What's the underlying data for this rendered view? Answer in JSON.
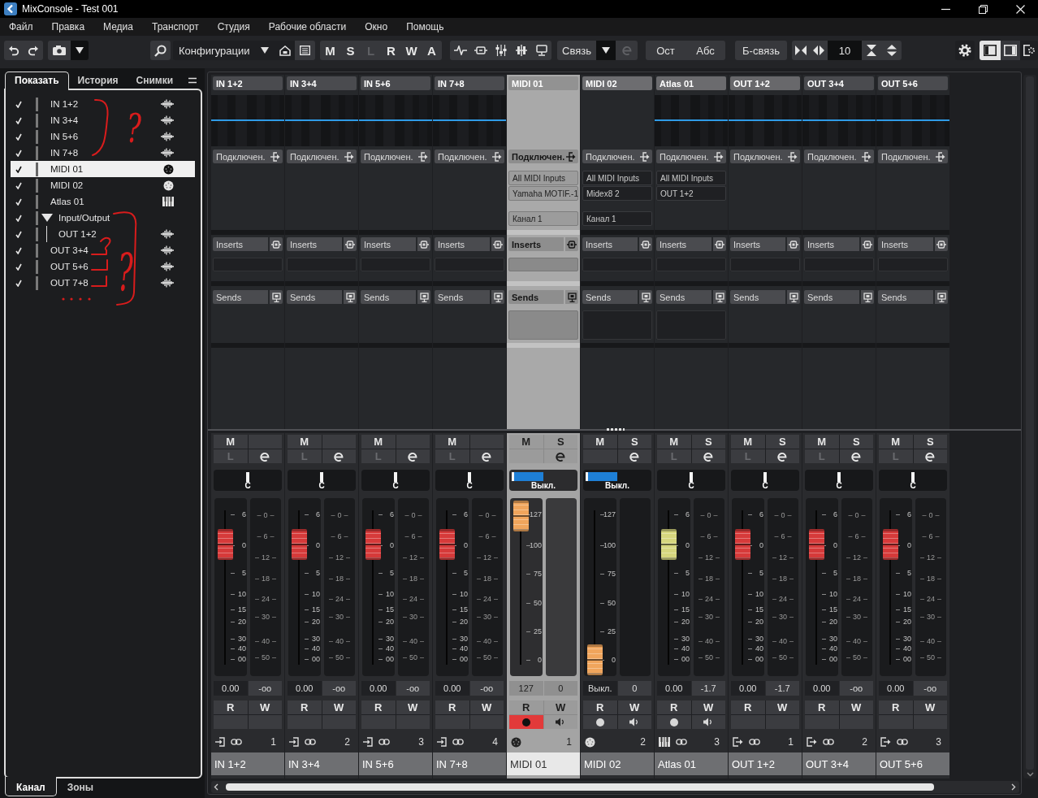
{
  "window": {
    "title": "MixConsole - Test 001"
  },
  "menu": [
    "Файл",
    "Правка",
    "Медиа",
    "Транспорт",
    "Студия",
    "Рабочие области",
    "Окно",
    "Помощь"
  ],
  "toolbar": {
    "configurations": "Конфигурации",
    "channel_buttons": [
      {
        "label": "M",
        "disabled": false
      },
      {
        "label": "S",
        "disabled": false
      },
      {
        "label": "L",
        "disabled": true
      },
      {
        "label": "R",
        "disabled": false
      },
      {
        "label": "W",
        "disabled": false
      },
      {
        "label": "A",
        "disabled": false
      }
    ],
    "link": "Связь",
    "mode_buttons": [
      "Ост",
      "Абс"
    ],
    "q_link": "Б-связь",
    "zoom": "10",
    "panel_toggles": [
      {
        "selected": true
      },
      {
        "selected": false
      }
    ]
  },
  "left_panel": {
    "tabs": [
      {
        "label": "Показать",
        "selected": true
      },
      {
        "label": "История",
        "selected": false
      },
      {
        "label": "Снимки",
        "selected": false
      }
    ],
    "channel_list": [
      {
        "name": "IN 1+2",
        "kind": "audio",
        "checked": true,
        "selected": false
      },
      {
        "name": "IN 3+4",
        "kind": "audio",
        "checked": true,
        "selected": false
      },
      {
        "name": "IN 5+6",
        "kind": "audio",
        "checked": true,
        "selected": false
      },
      {
        "name": "IN 7+8",
        "kind": "audio",
        "checked": true,
        "selected": false
      },
      {
        "name": "MIDI 01",
        "kind": "midi",
        "checked": true,
        "selected": true
      },
      {
        "name": "MIDI 02",
        "kind": "midi",
        "checked": true,
        "selected": false
      },
      {
        "name": "Atlas 01",
        "kind": "instrument",
        "checked": true,
        "selected": false
      },
      {
        "name": "Input/Output",
        "kind": "folder",
        "checked": true,
        "selected": false,
        "expanded": true,
        "children": [
          {
            "name": "OUT 1+2",
            "kind": "audio",
            "checked": true,
            "selected": false
          }
        ]
      },
      {
        "name": "OUT 3+4",
        "kind": "audio",
        "checked": true,
        "selected": false
      },
      {
        "name": "OUT 5+6",
        "kind": "audio",
        "checked": true,
        "selected": false
      },
      {
        "name": "OUT 7+8",
        "kind": "audio",
        "checked": true,
        "selected": false
      }
    ],
    "bottom_tabs": [
      {
        "label": "Канал",
        "selected": true
      },
      {
        "label": "Зоны",
        "selected": false
      }
    ],
    "annotations": [
      "?",
      "?"
    ]
  },
  "channels": [
    {
      "header": "IN 1+2",
      "kind": "input",
      "selected": false,
      "color": "#4a4b4f",
      "routing": "Подключен.",
      "inserts": "Inserts",
      "sends": "Sends",
      "mute": "M",
      "listen": "L",
      "pan": {
        "kind": "balance",
        "label": "C",
        "level": 0.5
      },
      "fader": {
        "level": 0.8,
        "color": "#d63a3a",
        "scale": [
          "6",
          "0",
          "5",
          "10",
          "15",
          "20",
          "30",
          "40",
          "00"
        ]
      },
      "meter_scale": [
        "0",
        "6",
        "12",
        "18",
        "24",
        "30",
        "40",
        "50"
      ],
      "volume": "0.00",
      "peak": "-oo",
      "read": "R",
      "write": "W",
      "number": "1",
      "name": "IN 1+2"
    },
    {
      "header": "IN 3+4",
      "kind": "input",
      "selected": false,
      "color": "#4a4b4f",
      "routing": "Подключен.",
      "inserts": "Inserts",
      "sends": "Sends",
      "mute": "M",
      "listen": "L",
      "pan": {
        "kind": "balance",
        "label": "C",
        "level": 0.5
      },
      "fader": {
        "level": 0.8,
        "color": "#d63a3a",
        "scale": [
          "6",
          "0",
          "5",
          "10",
          "15",
          "20",
          "30",
          "40",
          "00"
        ]
      },
      "meter_scale": [
        "0",
        "6",
        "12",
        "18",
        "24",
        "30",
        "40",
        "50"
      ],
      "volume": "0.00",
      "peak": "-oo",
      "read": "R",
      "write": "W",
      "number": "2",
      "name": "IN 3+4"
    },
    {
      "header": "IN 5+6",
      "kind": "input",
      "selected": false,
      "color": "#4a4b4f",
      "routing": "Подключен.",
      "inserts": "Inserts",
      "sends": "Sends",
      "mute": "M",
      "listen": "L",
      "pan": {
        "kind": "balance",
        "label": "C",
        "level": 0.5
      },
      "fader": {
        "level": 0.8,
        "color": "#d63a3a",
        "scale": [
          "6",
          "0",
          "5",
          "10",
          "15",
          "20",
          "30",
          "40",
          "00"
        ]
      },
      "meter_scale": [
        "0",
        "6",
        "12",
        "18",
        "24",
        "30",
        "40",
        "50"
      ],
      "volume": "0.00",
      "peak": "-oo",
      "read": "R",
      "write": "W",
      "number": "3",
      "name": "IN 5+6"
    },
    {
      "header": "IN 7+8",
      "kind": "input",
      "selected": false,
      "color": "#4a4b4f",
      "routing": "Подключен.",
      "inserts": "Inserts",
      "sends": "Sends",
      "mute": "M",
      "listen": "L",
      "pan": {
        "kind": "balance",
        "label": "C",
        "level": 0.5
      },
      "fader": {
        "level": 0.8,
        "color": "#d63a3a",
        "scale": [
          "6",
          "0",
          "5",
          "10",
          "15",
          "20",
          "30",
          "40",
          "00"
        ]
      },
      "meter_scale": [
        "0",
        "6",
        "12",
        "18",
        "24",
        "30",
        "40",
        "50"
      ],
      "volume": "0.00",
      "peak": "-oo",
      "read": "R",
      "write": "W",
      "number": "4",
      "name": "IN 7+8"
    },
    {
      "header": "MIDI 01",
      "kind": "midi",
      "selected": true,
      "color": "#929292",
      "routing": "Подключен.",
      "midi_inputs": [
        "All MIDI Inputs",
        "Yamaha MOTIF.-1"
      ],
      "midi_channel": "Канал 1",
      "inserts": "Inserts",
      "sends": "Sends",
      "mute": "M",
      "solo": "S",
      "pan": {
        "kind": "bar",
        "label": "Выкл.",
        "level": 0.5
      },
      "fader": {
        "level": 1,
        "color": "#f0a55c",
        "scale": [
          "127",
          "100",
          "75",
          "50",
          "25",
          "0"
        ]
      },
      "volume": "127",
      "peak": "0",
      "read": "R",
      "write": "W",
      "record_on": true,
      "number": "1",
      "name": "MIDI 01"
    },
    {
      "header": "MIDI 02",
      "kind": "midi",
      "selected": false,
      "color": "#6d6d70",
      "routing": "Подключен.",
      "midi_inputs": [
        "All MIDI Inputs",
        "Midex8 2"
      ],
      "midi_channel": "Канал 1",
      "inserts": "Inserts",
      "sends": "Sends",
      "mute": "M",
      "solo": "S",
      "pan": {
        "kind": "bar",
        "label": "Выкл.",
        "level": 0.5
      },
      "fader": {
        "level": 0,
        "color": "#f0a55c",
        "scale": [
          "127",
          "100",
          "75",
          "50",
          "25",
          "0"
        ]
      },
      "volume": "Выкл.",
      "peak": "0",
      "read": "R",
      "write": "W",
      "record_on": false,
      "number": "2",
      "name": "MIDI 02"
    },
    {
      "header": "Atlas 01",
      "kind": "instrument",
      "selected": false,
      "color": "#6b6b6e",
      "routing": "Подключен.",
      "midi_inputs": [
        "All MIDI Inputs",
        "OUT 1+2"
      ],
      "inserts": "Inserts",
      "sends": "Sends",
      "mute": "M",
      "solo": "S",
      "listen": "L",
      "pan": {
        "kind": "balance",
        "label": "C",
        "level": 0.5
      },
      "fader": {
        "level": 0.8,
        "color": "#d6d67e",
        "scale": [
          "6",
          "0",
          "5",
          "10",
          "15",
          "20",
          "30",
          "40",
          "00"
        ]
      },
      "meter_scale": [
        "0",
        "6",
        "12",
        "18",
        "24",
        "30",
        "40",
        "50"
      ],
      "volume": "0.00",
      "peak": "-1.7",
      "read": "R",
      "write": "W",
      "record_on": false,
      "number": "3",
      "name": "Atlas 01"
    },
    {
      "header": "OUT 1+2",
      "kind": "output",
      "selected": false,
      "color": "#68686b",
      "routing": "Подключен.",
      "inserts": "Inserts",
      "sends": "Sends",
      "mute": "M",
      "solo": "S",
      "listen": "L",
      "pan": {
        "kind": "balance",
        "label": "C",
        "level": 0.5
      },
      "fader": {
        "level": 0.8,
        "color": "#d63a3a",
        "scale": [
          "6",
          "0",
          "5",
          "10",
          "15",
          "20",
          "30",
          "40",
          "00"
        ]
      },
      "meter_scale": [
        "0",
        "6",
        "12",
        "18",
        "24",
        "30",
        "40",
        "50"
      ],
      "volume": "0.00",
      "peak": "-1.7",
      "read": "R",
      "write": "W",
      "number": "1",
      "name": "OUT 1+2"
    },
    {
      "header": "OUT 3+4",
      "kind": "output",
      "selected": false,
      "color": "#4a4b4f",
      "routing": "Подключен.",
      "inserts": "Inserts",
      "sends": "Sends",
      "mute": "M",
      "solo": "S",
      "listen": "L",
      "pan": {
        "kind": "balance",
        "label": "C",
        "level": 0.5
      },
      "fader": {
        "level": 0.8,
        "color": "#d63a3a",
        "scale": [
          "6",
          "0",
          "5",
          "10",
          "15",
          "20",
          "30",
          "40",
          "00"
        ]
      },
      "meter_scale": [
        "0",
        "6",
        "12",
        "18",
        "24",
        "30",
        "40",
        "50"
      ],
      "volume": "0.00",
      "peak": "-oo",
      "read": "R",
      "write": "W",
      "number": "2",
      "name": "OUT 3+4"
    },
    {
      "header": "OUT 5+6",
      "kind": "output",
      "selected": false,
      "color": "#4a4b4f",
      "routing": "Подключен.",
      "inserts": "Inserts",
      "sends": "Sends",
      "mute": "M",
      "solo": "S",
      "listen": "L",
      "pan": {
        "kind": "balance",
        "label": "C",
        "level": 0.5
      },
      "fader": {
        "level": 0.8,
        "color": "#d63a3a",
        "scale": [
          "6",
          "0",
          "5",
          "10",
          "15",
          "20",
          "30",
          "40",
          "00"
        ]
      },
      "meter_scale": [
        "0",
        "6",
        "12",
        "18",
        "24",
        "30",
        "40",
        "50"
      ],
      "volume": "0.00",
      "peak": "-oo",
      "read": "R",
      "write": "W",
      "number": "3",
      "name": "OUT 5+6"
    }
  ]
}
